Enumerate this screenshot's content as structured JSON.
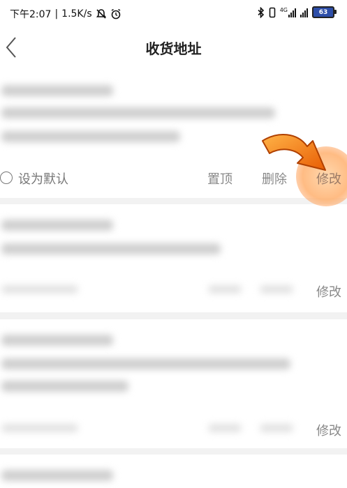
{
  "status_bar": {
    "time": "下午2:07",
    "separator": "|",
    "network_speed": "1.5K/s",
    "network_type": "4G",
    "battery": "63",
    "icons": [
      "mute-icon",
      "alarm-icon",
      "bluetooth-icon",
      "vibrate-icon",
      "signal-icon",
      "signal-icon",
      "battery-icon"
    ]
  },
  "header": {
    "title": "收货地址",
    "back_icon": "chevron-left-icon"
  },
  "address_cards": [
    {
      "set_default_label": "设为默认",
      "pin_top_label": "置顶",
      "delete_label": "删除",
      "edit_label": "修改"
    },
    {
      "edit_label": "修改"
    },
    {
      "edit_label": "修改"
    }
  ],
  "annotation": {
    "arrow_icon": "orange-arrow-icon",
    "highlight_color": "#ff9a4d"
  }
}
